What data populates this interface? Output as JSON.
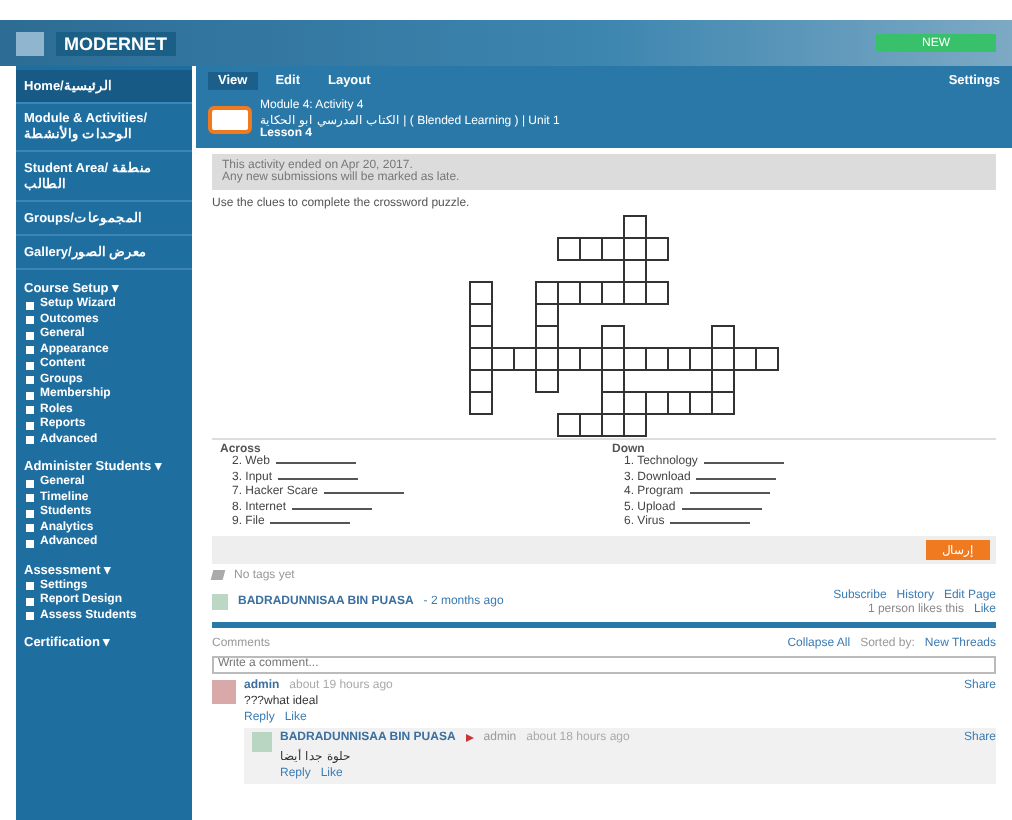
{
  "header": {
    "site": "MODERNET",
    "button": "NEW"
  },
  "sidebar": {
    "items": [
      {
        "label": "Home/الرئيسية",
        "selected": true
      },
      {
        "label": "Module & Activities/الوحدات والأنشطة",
        "selected": false
      },
      {
        "label": "Student Area/ منطقة الطالب",
        "selected": false
      },
      {
        "label": "Groups/المجموعات",
        "selected": false
      },
      {
        "label": "Gallery/معرض الصور",
        "selected": false
      }
    ],
    "sections": [
      {
        "title": "Course Setup ▾",
        "items": [
          "Setup Wizard",
          "Outcomes",
          "General",
          "Appearance",
          "Content",
          "Groups",
          "Membership",
          "Roles",
          "Reports",
          "Advanced"
        ]
      },
      {
        "title": "Administer Students ▾",
        "items": [
          "General",
          "Timeline",
          "Students",
          "Analytics",
          "Advanced"
        ]
      },
      {
        "title": "Assessment ▾",
        "items": [
          "Settings",
          "Report Design",
          "Assess Students"
        ]
      },
      {
        "title": "Certification ▾"
      }
    ]
  },
  "toolbar": {
    "tabs": [
      {
        "label": "View",
        "selected": true
      },
      {
        "label": "Edit",
        "selected": false
      },
      {
        "label": "Layout",
        "selected": false
      }
    ],
    "settings": "Settings"
  },
  "page": {
    "breadcrumb": "Module 4: Activity 4",
    "title": "الكتاب المدرسي ابو الحكاية | ( Blended Learning ) | Unit 1",
    "subtitle": "Lesson 4",
    "notice": [
      "This activity ended on Apr 20, 2017.",
      "Any new submissions will be marked as late."
    ],
    "instruction": "Use the clues to complete the crossword puzzle.",
    "across_title": "Across",
    "across": [
      "2. Web",
      "3. Input",
      "7. Hacker Scare",
      "8. Internet",
      "9. File"
    ],
    "down_title": "Down",
    "down": [
      "1. Technology",
      "3. Download",
      "4. Program",
      "5. Upload",
      "6. Virus"
    ],
    "submit": "إرسال",
    "tags": "No tags yet",
    "author": "BADRADUNNISAA BIN PUASA",
    "date": "- 2 months ago",
    "actions": [
      "Subscribe",
      "History",
      "Edit Page"
    ],
    "likes": "1 person likes this",
    "like": "Like"
  },
  "comments": {
    "title": "Comments",
    "collapse": "Collapse All",
    "sorted_label": "Sorted by:",
    "sorted_value": "New Threads",
    "placeholder": "Write a comment...",
    "items": [
      {
        "author": "admin",
        "time": "about 19 hours ago",
        "text": "???what ideal",
        "reply": "Reply",
        "like": "Like",
        "share": "Share",
        "children": [
          {
            "author": "BADRADUNNISAA BIN PUASA",
            "to": "admin",
            "time": "about 18 hours ago",
            "text": "حلوة جدا أيضا",
            "reply": "Reply",
            "like": "Like",
            "share": "Share"
          }
        ]
      }
    ]
  }
}
